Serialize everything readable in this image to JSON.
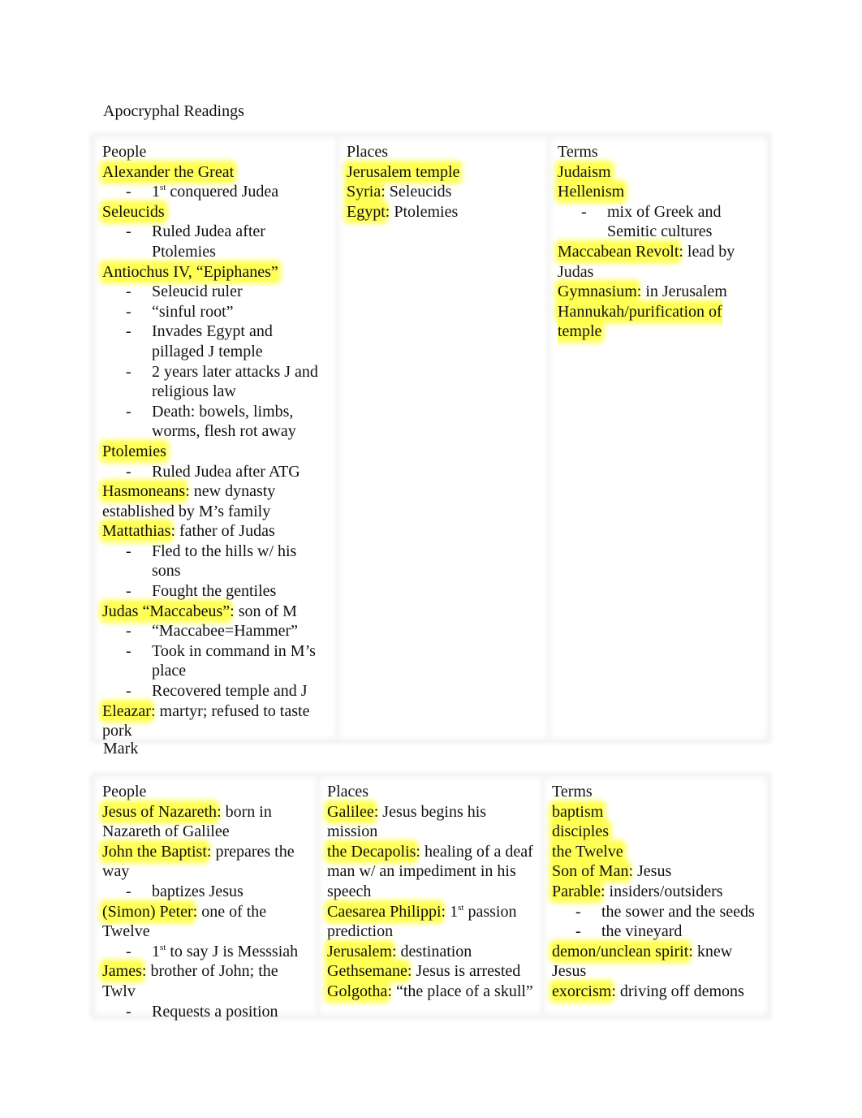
{
  "document": {
    "title": "Apocryphal Readings",
    "highlight_color": "#ffff55",
    "apocrypha": {
      "people": {
        "header": "People",
        "entries": [
          {
            "term": "Alexander the Great",
            "rest": "",
            "notes": [
              {
                "sup_prefix": "1",
                "sup": "st",
                "text": " conquered Judea"
              }
            ]
          },
          {
            "term": "Seleucids",
            "rest": "",
            "notes": [
              {
                "text": "Ruled Judea after Ptolemies"
              }
            ]
          },
          {
            "term": "Antiochus IV, “Epiphanes”",
            "rest": "",
            "notes": [
              {
                "text": "Seleucid ruler"
              },
              {
                "text": "“sinful root”"
              },
              {
                "text": "Invades Egypt and pillaged J temple"
              },
              {
                "text": "2 years later attacks J and religious law"
              },
              {
                "text": "Death: bowels, limbs, worms, flesh rot away"
              }
            ]
          },
          {
            "term": "Ptolemies",
            "rest": "",
            "notes": [
              {
                "text": "Ruled Judea after ATG"
              }
            ]
          },
          {
            "term": "Hasmoneans",
            "rest": ": new dynasty established by M’s family",
            "notes": []
          },
          {
            "term": "Mattathias",
            "rest": ": father of Judas",
            "notes": [
              {
                "text": "Fled to the hills w/ his sons"
              },
              {
                "text": "Fought the gentiles"
              }
            ]
          },
          {
            "term": "Judas “Maccabeus”",
            "rest": ": son of M",
            "notes": [
              {
                "text": "“Maccabee=Hammer”"
              },
              {
                "text": "Took in command in M’s place"
              },
              {
                "text": "Recovered temple and J"
              }
            ]
          },
          {
            "term": "Eleazar",
            "rest": ": martyr; refused to taste pork",
            "notes": []
          }
        ]
      },
      "places": {
        "header": "Places",
        "entries": [
          {
            "term": "Jerusalem temple",
            "rest": ""
          },
          {
            "term": "Syria",
            "rest": ": Seleucids"
          },
          {
            "term": "Egypt",
            "rest": ": Ptolemies"
          }
        ]
      },
      "terms": {
        "header": "Terms",
        "entries": [
          {
            "term": "Judaism",
            "rest": "",
            "notes": []
          },
          {
            "term": "Hellenism",
            "rest": "",
            "notes": [
              {
                "text": "mix of Greek and Semitic cultures"
              }
            ]
          },
          {
            "term": "Maccabean Revolt",
            "rest": ": lead by Judas",
            "notes": []
          },
          {
            "term": "Gymnasium",
            "rest": ": in Jerusalem",
            "notes": []
          },
          {
            "term": "Hannukah/purification of temple",
            "rest": "",
            "notes": []
          }
        ]
      }
    },
    "mark_label": "Mark",
    "mark": {
      "people": {
        "header": "People",
        "entries": [
          {
            "term": "Jesus of Nazareth",
            "rest": ": born in Nazareth of Galilee",
            "notes": []
          },
          {
            "term": "John the Baptist",
            "rest": ": prepares the way",
            "notes": [
              {
                "text": "baptizes Jesus"
              }
            ]
          },
          {
            "term": "(Simon) Peter",
            "rest": ": one of the Twelve",
            "notes": [
              {
                "sup_prefix": "1",
                "sup": "st",
                "text": " to say J is Messsiah"
              }
            ]
          },
          {
            "term": "James",
            "rest": ": brother of John; the Twlv",
            "notes": [
              {
                "text": "Requests a position"
              }
            ]
          }
        ]
      },
      "places": {
        "header": "Places",
        "entries": [
          {
            "term": "Galilee",
            "rest": ": Jesus begins his mission"
          },
          {
            "term": "the Decapolis",
            "rest": ": healing of a deaf man w/ an impediment in his speech"
          },
          {
            "term": "Caesarea Philippi",
            "rest": ": 1",
            "sup": "st",
            "rest2": " passion prediction"
          },
          {
            "term": "Jerusalem",
            "rest": ": destination"
          },
          {
            "term": "Gethsemane",
            "rest": ": Jesus is arrested"
          },
          {
            "term": "Golgotha",
            "rest": ": “the place of a skull”"
          }
        ]
      },
      "terms": {
        "header": "Terms",
        "entries": [
          {
            "term": "baptism",
            "rest": "",
            "notes": []
          },
          {
            "term": "disciples",
            "rest": "",
            "notes": []
          },
          {
            "term": "the Twelve",
            "rest": "",
            "notes": []
          },
          {
            "term": "Son of Man",
            "rest": ": Jesus",
            "notes": []
          },
          {
            "term": "Parable",
            "rest": ": insiders/outsiders",
            "notes": [
              {
                "text": "the sower and the seeds"
              },
              {
                "text": "the vineyard"
              }
            ]
          },
          {
            "term": "demon/unclean spirit",
            "rest": ": knew Jesus",
            "notes": []
          },
          {
            "term": "exorcism",
            "rest": ": driving off demons",
            "notes": []
          }
        ]
      }
    }
  }
}
